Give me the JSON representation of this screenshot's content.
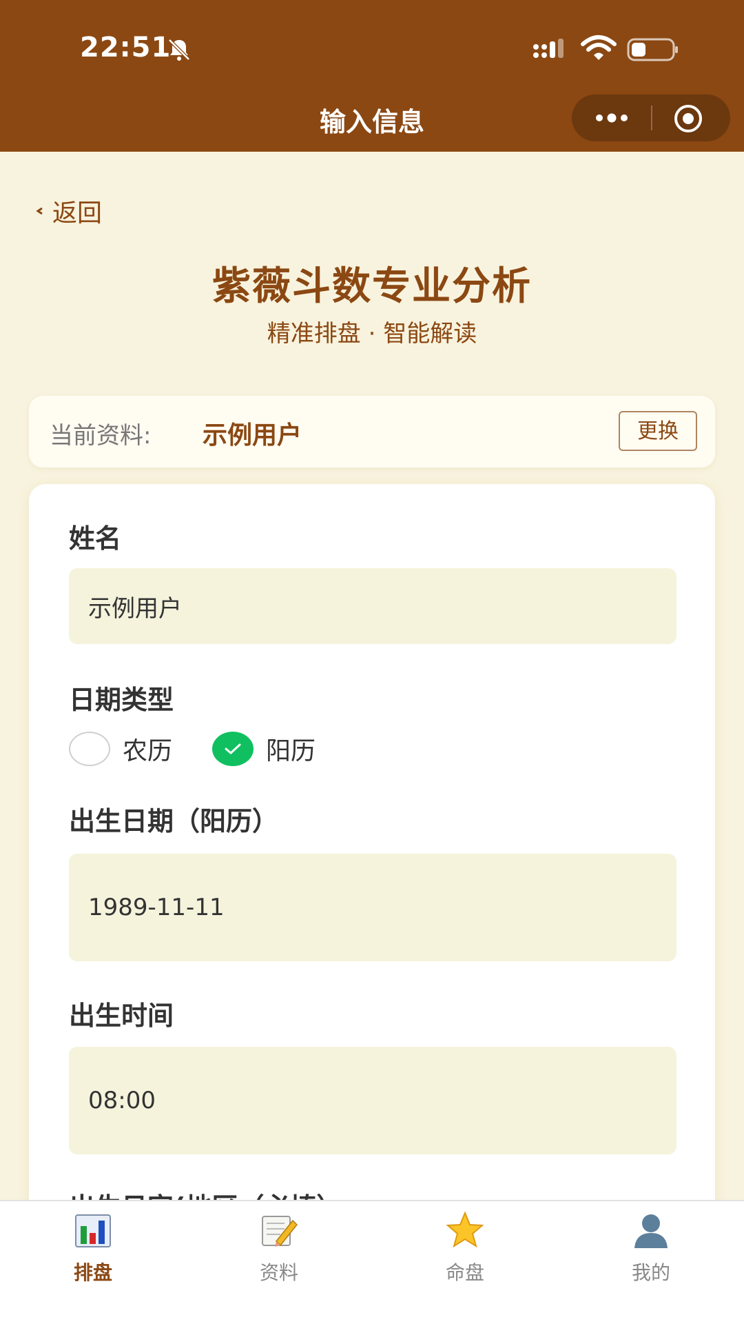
{
  "status_bar": {
    "time": "22:51"
  },
  "nav": {
    "title": "输入信息"
  },
  "back_label": "返回",
  "header": {
    "title": "紫薇斗数专业分析",
    "subtitle": "精准排盘 · 智能解读"
  },
  "profile": {
    "label": "当前资料:",
    "name": "示例用户",
    "change_label": "更换"
  },
  "form": {
    "name_label": "姓名",
    "name_value": "示例用户",
    "date_type_label": "日期类型",
    "date_type_options": [
      "农历",
      "阳历"
    ],
    "date_type_selected": "阳历",
    "birth_date_label": "出生日期（阳历）",
    "birth_date_value": "1989-11-11",
    "birth_time_label": "出生时间",
    "birth_time_value": "08:00",
    "cut_off_label": "出生日字(地区（必填）"
  },
  "tabs": [
    {
      "label": "排盘",
      "icon": "bar-chart-icon",
      "active": true
    },
    {
      "label": "资料",
      "icon": "memo-pencil-icon",
      "active": false
    },
    {
      "label": "命盘",
      "icon": "star-icon",
      "active": false
    },
    {
      "label": "我的",
      "icon": "user-silhouette-icon",
      "active": false
    }
  ],
  "colors": {
    "brand": "#8b4813",
    "background": "#f8f3de",
    "input_bg": "#f5f3dc",
    "selected_radio": "#10c060"
  }
}
